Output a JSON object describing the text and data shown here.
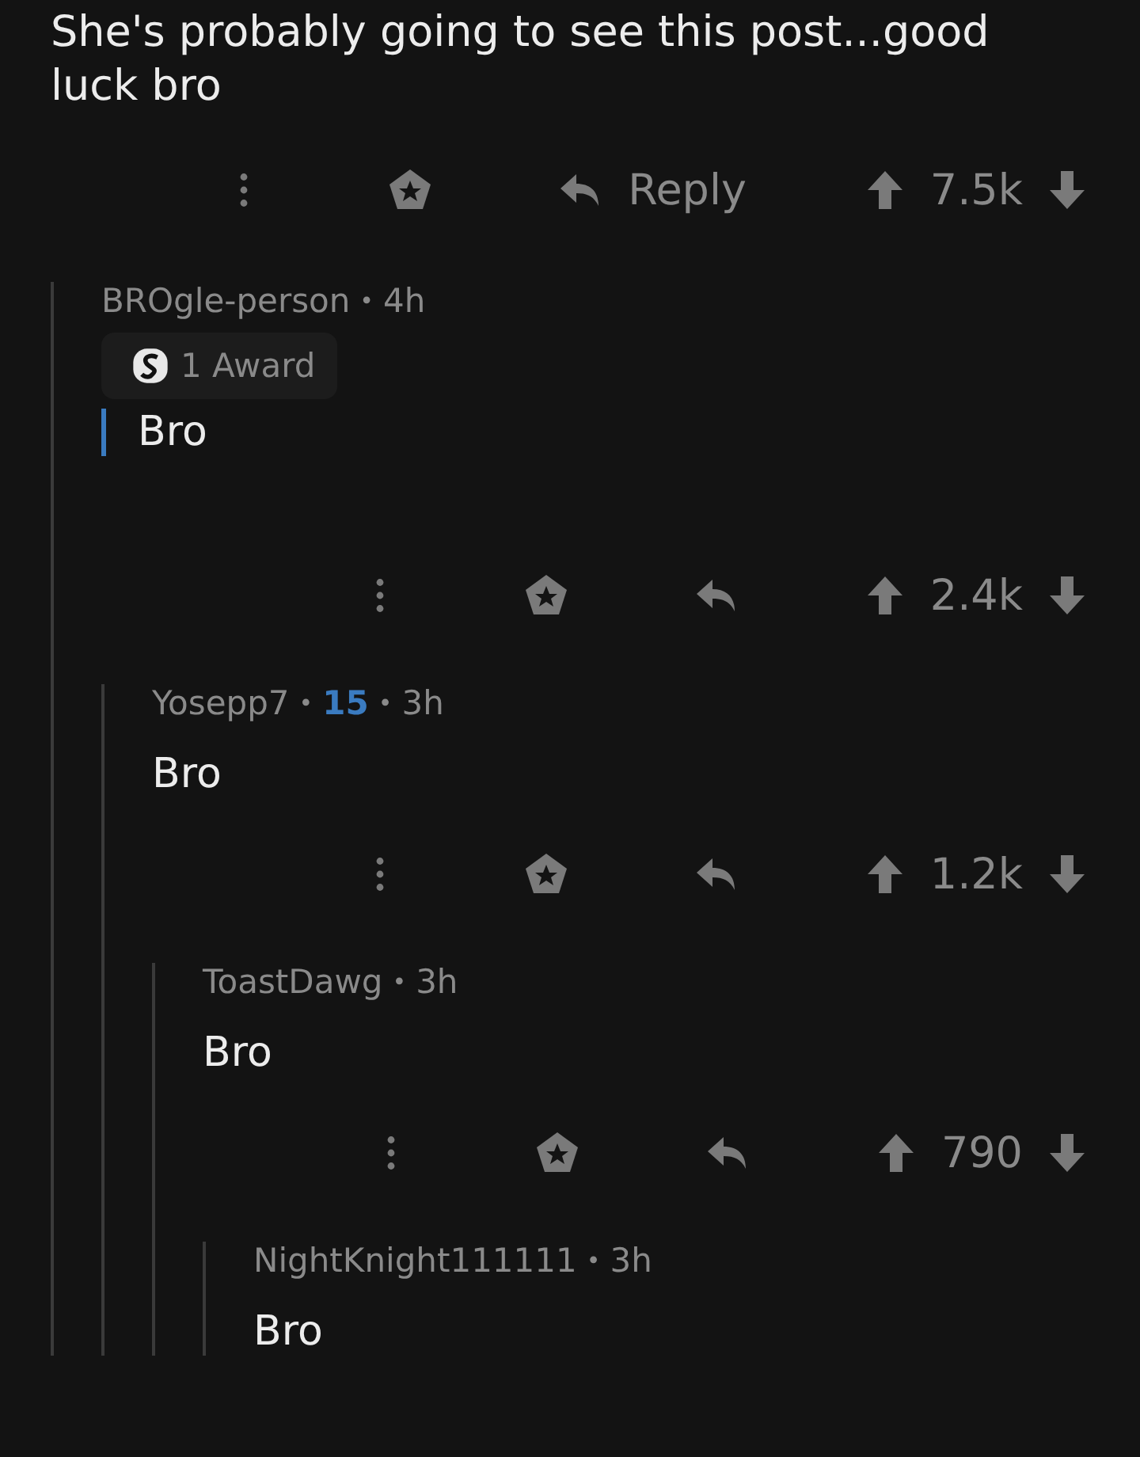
{
  "post": {
    "title": "She's probably going to see this post...good luck bro",
    "actions": {
      "reply_label": "Reply",
      "score": "7.5k"
    }
  },
  "comments": [
    {
      "meta": [
        {
          "kind": "author",
          "text": "BROgle-person"
        },
        {
          "kind": "separator",
          "text": "•"
        },
        {
          "kind": "time",
          "text": "4h"
        }
      ],
      "awards": "1 Award",
      "body": "Bro",
      "quoted": true,
      "actions": {
        "score": "2.4k"
      },
      "children": [
        {
          "meta": [
            {
              "kind": "author",
              "text": "Yosepp7"
            },
            {
              "kind": "separator",
              "text": "•"
            },
            {
              "kind": "score",
              "text": "15"
            },
            {
              "kind": "separator",
              "text": "•"
            },
            {
              "kind": "time",
              "text": "3h"
            }
          ],
          "body": "Bro",
          "quoted": false,
          "actions": {
            "score": "1.2k"
          },
          "children": [
            {
              "meta": [
                {
                  "kind": "author",
                  "text": "ToastDawg"
                },
                {
                  "kind": "separator",
                  "text": "•"
                },
                {
                  "kind": "time",
                  "text": "3h"
                }
              ],
              "body": "Bro",
              "quoted": false,
              "actions": {
                "score": "790"
              },
              "children": [
                {
                  "meta": [
                    {
                      "kind": "author",
                      "text": "NightKnight111111"
                    },
                    {
                      "kind": "separator",
                      "text": "•"
                    },
                    {
                      "kind": "time",
                      "text": "3h"
                    }
                  ],
                  "body": "Bro",
                  "quoted": false
                }
              ]
            }
          ]
        }
      ]
    }
  ]
}
